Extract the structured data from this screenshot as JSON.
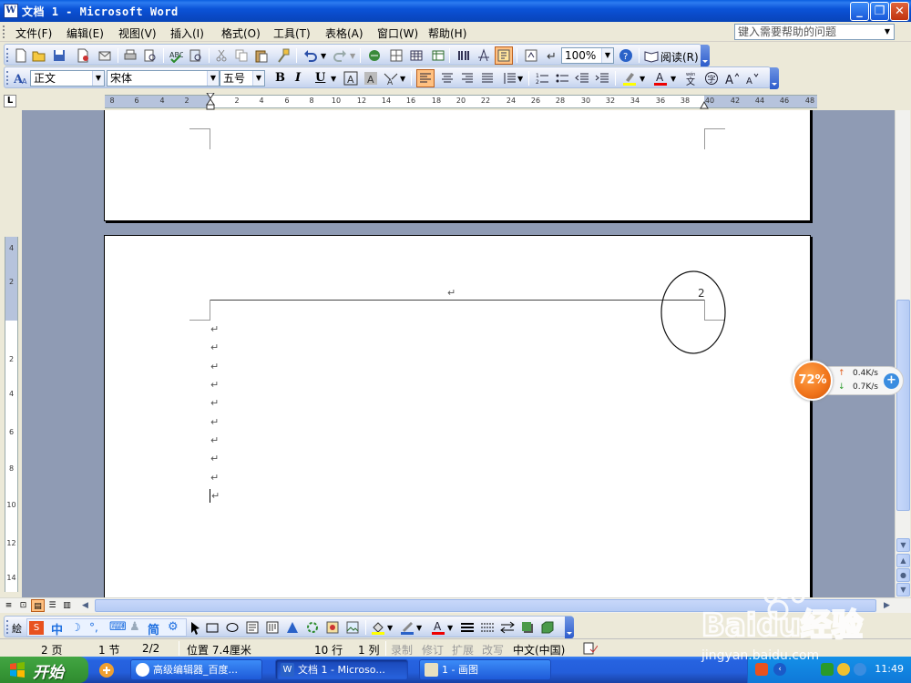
{
  "window": {
    "title": "文档 1 - Microsoft Word",
    "icon": "word-doc-icon"
  },
  "menubar": {
    "items": [
      "文件(F)",
      "编辑(E)",
      "视图(V)",
      "插入(I)",
      "格式(O)",
      "工具(T)",
      "表格(A)",
      "窗口(W)",
      "帮助(H)"
    ],
    "help_placeholder": "键入需要帮助的问题"
  },
  "standard_toolbar": {
    "zoom": "100%",
    "read_label": "阅读(R)"
  },
  "format_toolbar": {
    "style": "正文",
    "font": "宋体",
    "size": "五号",
    "bold": "B",
    "italic": "I",
    "underline": "U"
  },
  "ruler": {
    "h_ticks": [
      "8",
      "6",
      "4",
      "2",
      "",
      "2",
      "4",
      "6",
      "8",
      "10",
      "12",
      "14",
      "16",
      "18",
      "20",
      "22",
      "24",
      "26",
      "28",
      "30",
      "32",
      "34",
      "36",
      "38",
      "40",
      "42",
      "44",
      "46",
      "48"
    ],
    "v_ticks": [
      "4",
      "2",
      "",
      "2",
      "4",
      "6",
      "8",
      "10",
      "12",
      "14"
    ]
  },
  "document": {
    "page_number": "2",
    "return_mark": "↵"
  },
  "speed_widget": {
    "percent": "72%",
    "upload": "0.4K/s",
    "download": "0.7K/s"
  },
  "statusbar": {
    "page": "2 页",
    "section": "1 节",
    "page_of": "2/2",
    "position": "位置 7.4厘米",
    "line": "10 行",
    "column": "1 列",
    "rec": "录制",
    "trk": "修订",
    "ext": "扩展",
    "ovr": "改写",
    "language": "中文(中国)"
  },
  "taskbar": {
    "start_label": "开始",
    "tasks": [
      {
        "label": "高级编辑器_百度...",
        "active": false
      },
      {
        "label": "文档 1 - Microso...",
        "active": true
      },
      {
        "label": "1 - 画图",
        "active": false
      }
    ],
    "clock": "11:49"
  },
  "watermark": {
    "text": "Baidu经验",
    "url": "jingyan.baidu.com"
  },
  "colors": {
    "titlebar": "#0a54d8",
    "doc_background": "#8f9bb4",
    "start_green": "#389938",
    "speed_orange": "#f0731a"
  }
}
